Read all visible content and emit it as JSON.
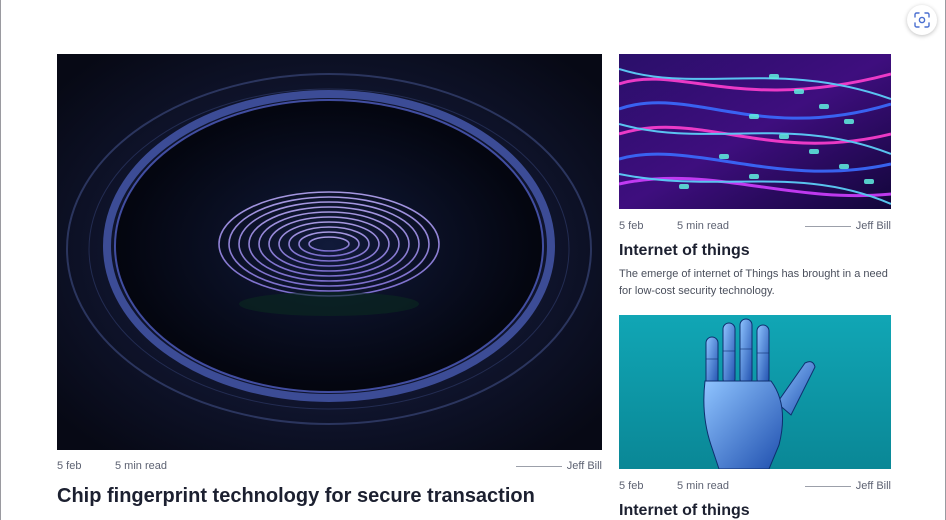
{
  "toolbar": {
    "scan_icon": "focus-scan-icon"
  },
  "featured": {
    "image": "fingerprint-sensor-image",
    "date": "5 feb",
    "read_time": "5 min read",
    "author": "Jeff Bill",
    "title": "Chip fingerprint technology for secure transaction"
  },
  "articles": [
    {
      "image": "light-trails-keyboard-image",
      "date": "5 feb",
      "read_time": "5 min read",
      "author": "Jeff Bill",
      "title": "Internet of things",
      "description": "The emerge of internet of Things has brought in a need for low-cost security technology."
    },
    {
      "image": "robotic-hand-image",
      "date": "5 feb",
      "read_time": "5 min read",
      "author": "Jeff Bill",
      "title": "Internet of things"
    }
  ]
}
